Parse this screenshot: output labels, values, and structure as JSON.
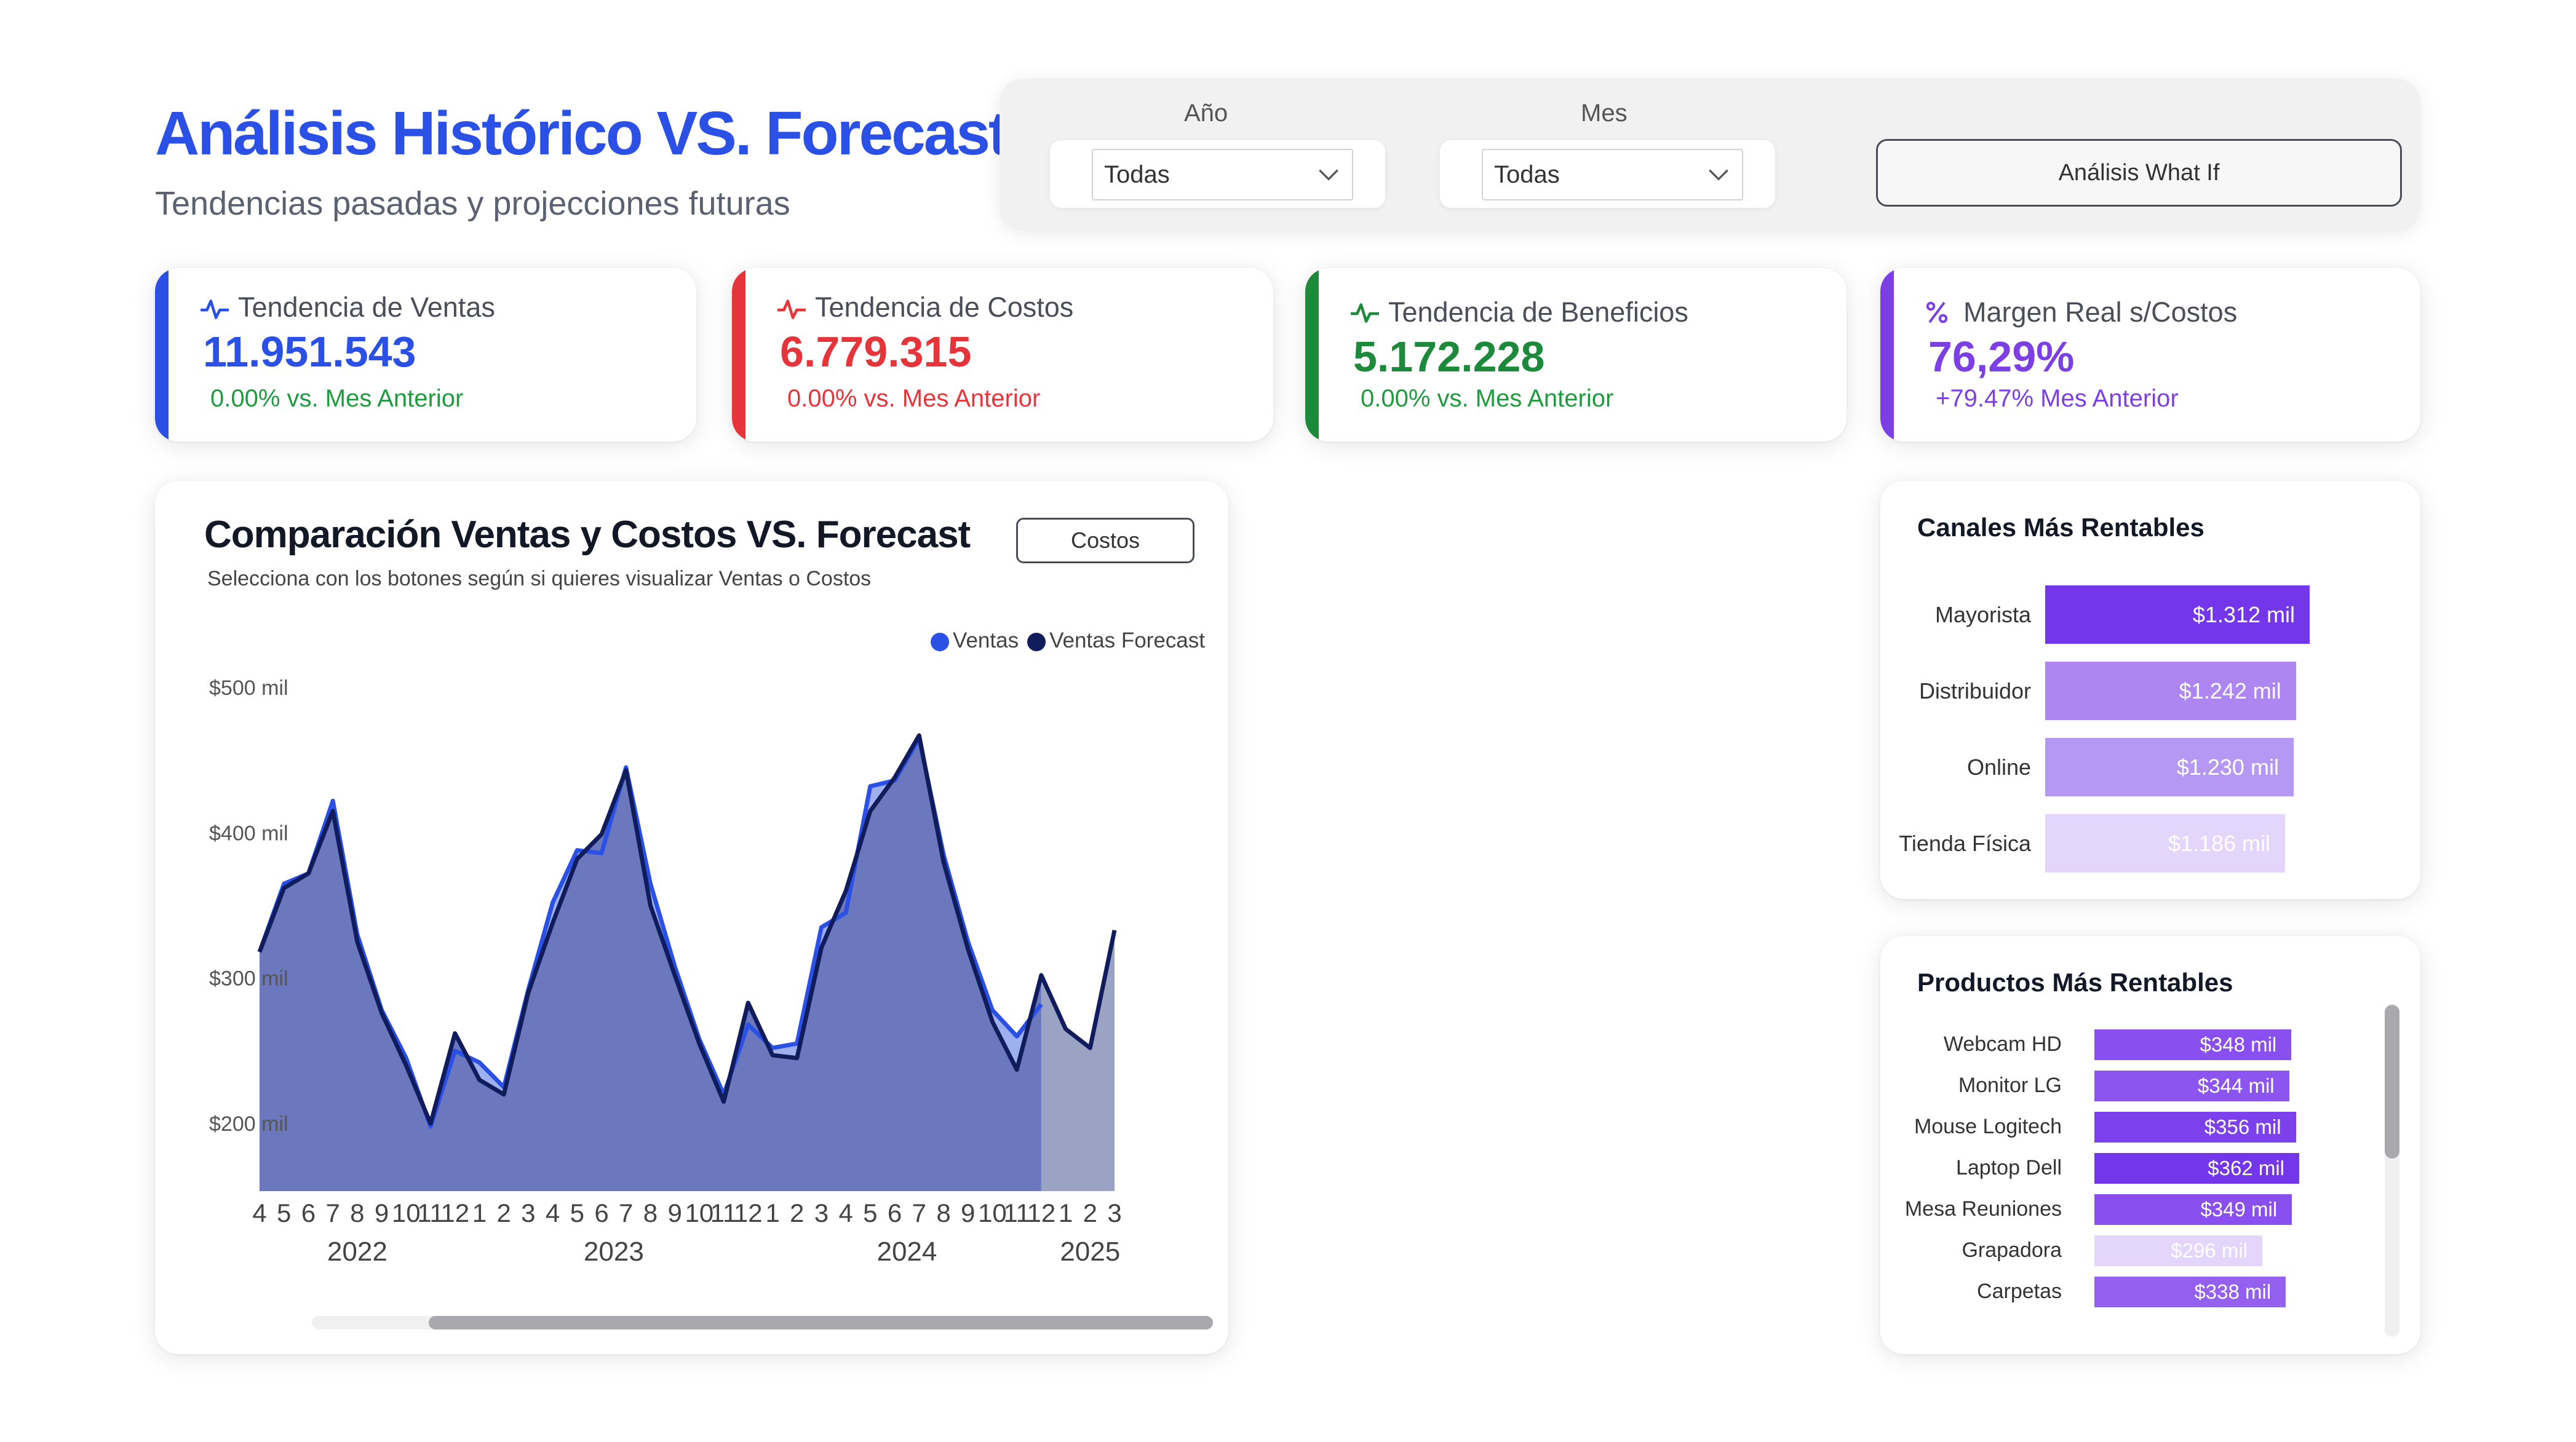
{
  "header": {
    "title": "Análisis Histórico VS. Forecast",
    "subtitle": "Tendencias pasadas y projecciones futuras"
  },
  "filters": {
    "year_label": "Año",
    "year_value": "Todas",
    "month_label": "Mes",
    "month_value": "Todas",
    "whatif_label": "Análisis What If"
  },
  "kpis": [
    {
      "label": "Tendencia de Ventas",
      "value": "11.951.543",
      "delta": "0.00% vs. Mes Anterior",
      "icon": "pulse-icon",
      "accent": "#2b50e6",
      "value_color": "#2b50e6",
      "delta_color": "#1f9a3e"
    },
    {
      "label": "Tendencia de Costos",
      "value": "6.779.315",
      "delta": "0.00% vs. Mes Anterior",
      "icon": "pulse-icon",
      "accent": "#e5343a",
      "value_color": "#e5343a",
      "delta_color": "#e5343a"
    },
    {
      "label": "Tendencia de Beneficios",
      "value": "5.172.228",
      "delta": "0.00% vs. Mes Anterior",
      "icon": "pulse-icon",
      "accent": "#1c8a3a",
      "value_color": "#1c8a3a",
      "delta_color": "#1f9a3e"
    },
    {
      "label": "Margen Real s/Costos",
      "value": "76,29%",
      "delta": "+79.47% Mes Anterior",
      "icon": "percent-icon",
      "accent": "#7b3fe4",
      "value_color": "#7b3fe4",
      "delta_color": "#7b3fe4"
    }
  ],
  "chart": {
    "title": "Comparación Ventas y Costos VS. Forecast",
    "subtitle": "Selecciona con los botones según si quieres visualizar Ventas o Costos",
    "costos_label": "Costos",
    "legend": [
      {
        "name": "Ventas",
        "color": "#2b50e6"
      },
      {
        "name": "Ventas Forecast",
        "color": "#101c5c"
      }
    ]
  },
  "chart_data": {
    "type": "area",
    "x": [
      "2022-04",
      "2022-05",
      "2022-06",
      "2022-07",
      "2022-08",
      "2022-09",
      "2022-10",
      "2022-11",
      "2022-12",
      "2023-01",
      "2023-02",
      "2023-03",
      "2023-04",
      "2023-05",
      "2023-06",
      "2023-07",
      "2023-08",
      "2023-09",
      "2023-10",
      "2023-11",
      "2023-12",
      "2024-01",
      "2024-02",
      "2024-03",
      "2024-04",
      "2024-05",
      "2024-06",
      "2024-07",
      "2024-08",
      "2024-09",
      "2024-10",
      "2024-11",
      "2024-12",
      "2025-01",
      "2025-02",
      "2025-03"
    ],
    "tick_labels": [
      "4",
      "5",
      "6",
      "7",
      "8",
      "9",
      "10",
      "11",
      "12",
      "1",
      "2",
      "3",
      "4",
      "5",
      "6",
      "7",
      "8",
      "9",
      "10",
      "11",
      "12",
      "1",
      "2",
      "3",
      "4",
      "5",
      "6",
      "7",
      "8",
      "9",
      "10",
      "11",
      "12",
      "1",
      "2",
      "3"
    ],
    "year_labels": [
      {
        "label": "2022",
        "index": 4
      },
      {
        "label": "2023",
        "index": 14.5
      },
      {
        "label": "2024",
        "index": 26.5
      },
      {
        "label": "2025",
        "index": 34
      }
    ],
    "series": [
      {
        "name": "Ventas",
        "color": "#2b50e6",
        "values": [
          318,
          365,
          372,
          422,
          330,
          278,
          245,
          198,
          250,
          242,
          225,
          292,
          352,
          388,
          386,
          445,
          365,
          308,
          258,
          220,
          268,
          252,
          255,
          335,
          345,
          432,
          436,
          465,
          385,
          325,
          278,
          260,
          282,
          null,
          null,
          null
        ]
      },
      {
        "name": "Ventas Forecast",
        "color": "#101c5c",
        "values": [
          318,
          362,
          372,
          415,
          325,
          276,
          240,
          200,
          262,
          230,
          220,
          290,
          338,
          382,
          399,
          443,
          350,
          302,
          255,
          215,
          283,
          247,
          245,
          321,
          360,
          415,
          438,
          467,
          380,
          320,
          270,
          237,
          302,
          265,
          252,
          333
        ]
      }
    ],
    "yticks": [
      {
        "value": 200,
        "label": "$200 mil"
      },
      {
        "value": 300,
        "label": "$300 mil"
      },
      {
        "value": 400,
        "label": "$400 mil"
      },
      {
        "value": 500,
        "label": "$500 mil"
      }
    ],
    "ylim": [
      150,
      500
    ],
    "grid": false,
    "legend_position": "top-right",
    "fill_color": "#6b78bd",
    "forecast_fill_color": "#9ba3c5"
  },
  "channels": {
    "title": "Canales Más Rentables",
    "max_value": 1312,
    "items": [
      {
        "label": "Mayorista",
        "value_label": "$1.312 mil",
        "value": 1312,
        "color": "#7436ea"
      },
      {
        "label": "Distribuidor",
        "value_label": "$1.242 mil",
        "value": 1242,
        "color": "#ad86f2"
      },
      {
        "label": "Online",
        "value_label": "$1.230 mil",
        "value": 1230,
        "color": "#b498f3"
      },
      {
        "label": "Tienda Física",
        "value_label": "$1.186 mil",
        "value": 1186,
        "color": "#e3d5fb"
      }
    ]
  },
  "products": {
    "title": "Productos Más Rentables",
    "max_value": 362,
    "items": [
      {
        "label": "Webcam HD",
        "value_label": "$348 mil",
        "value": 348,
        "color": "#8a50ef"
      },
      {
        "label": "Monitor LG",
        "value_label": "$344 mil",
        "value": 344,
        "color": "#8d55ef"
      },
      {
        "label": "Mouse Logitech",
        "value_label": "$356 mil",
        "value": 356,
        "color": "#7c40ec"
      },
      {
        "label": "Laptop Dell",
        "value_label": "$362 mil",
        "value": 362,
        "color": "#7436ea"
      },
      {
        "label": "Mesa Reuniones",
        "value_label": "$349 mil",
        "value": 349,
        "color": "#8a50ef"
      },
      {
        "label": "Grapadora",
        "value_label": "$296 mil",
        "value": 296,
        "color": "#e3d5fb"
      },
      {
        "label": "Carpetas",
        "value_label": "$338 mil",
        "value": 338,
        "color": "#9360f0"
      }
    ]
  }
}
